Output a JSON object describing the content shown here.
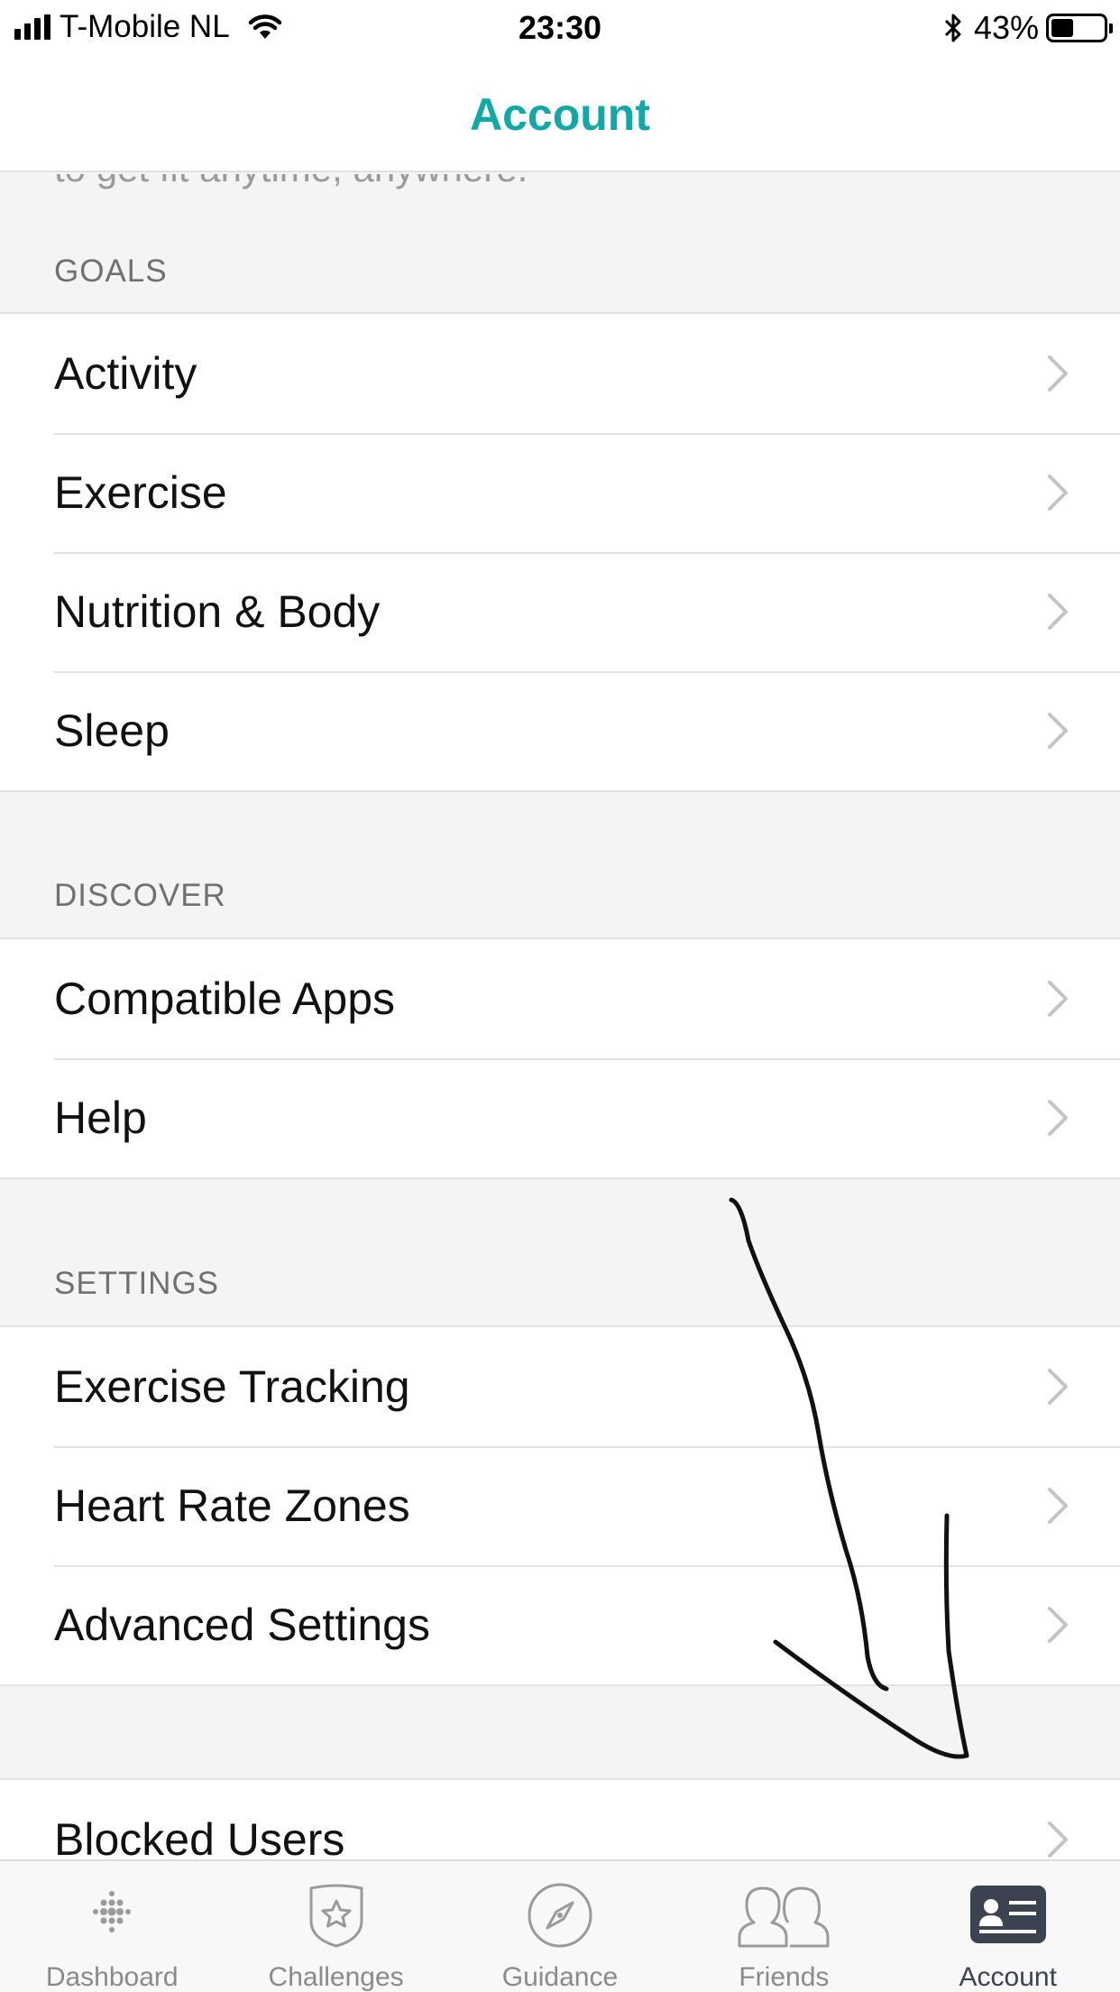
{
  "status_bar": {
    "carrier": "T-Mobile NL",
    "time": "23:30",
    "battery_percent": "43%",
    "battery_level": 0.43
  },
  "nav": {
    "title": "Account"
  },
  "content": {
    "cut_off_text": "to get fit anytime, anywhere.",
    "sections": [
      {
        "header": "GOALS",
        "items": [
          "Activity",
          "Exercise",
          "Nutrition & Body",
          "Sleep"
        ]
      },
      {
        "header": "DISCOVER",
        "items": [
          "Compatible Apps",
          "Help"
        ]
      },
      {
        "header": "SETTINGS",
        "items": [
          "Exercise Tracking",
          "Heart Rate Zones",
          "Advanced Settings"
        ]
      },
      {
        "header": "",
        "items": [
          "Blocked Users"
        ]
      }
    ]
  },
  "tabs": [
    {
      "label": "Dashboard",
      "icon": "dots-grid-icon",
      "active": false
    },
    {
      "label": "Challenges",
      "icon": "star-badge-icon",
      "active": false
    },
    {
      "label": "Guidance",
      "icon": "compass-icon",
      "active": false
    },
    {
      "label": "Friends",
      "icon": "friends-icon",
      "active": false
    },
    {
      "label": "Account",
      "icon": "account-card-icon",
      "active": true
    }
  ],
  "colors": {
    "accent": "#12a8a8",
    "tab_active": "#3b4250",
    "tab_inactive": "#8a8a8a"
  }
}
